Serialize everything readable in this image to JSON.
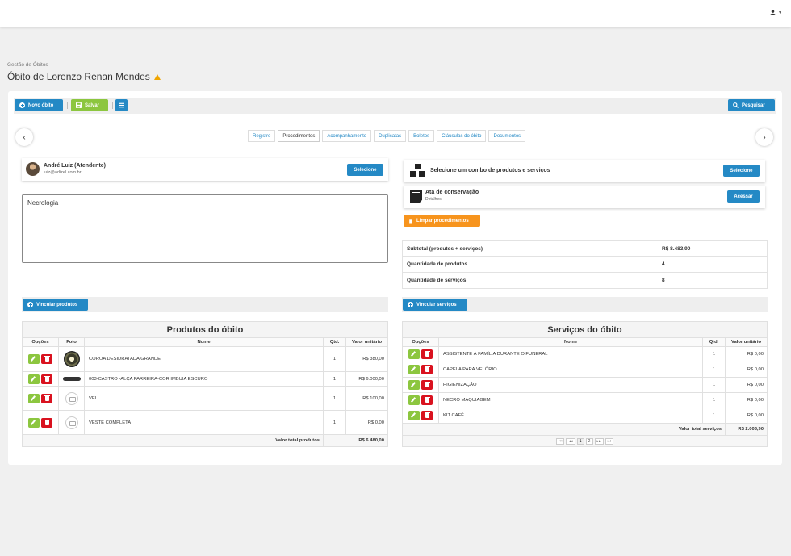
{
  "header": {
    "user_icon": "user-icon",
    "caret": "▾"
  },
  "breadcrumb": "Gestão de Óbitos",
  "page_title": "Óbito de Lorenzo Renan Mendes",
  "toolbar": {
    "new_label": "Novo óbito",
    "save_label": "Salvar",
    "search_label": "Pesquisar"
  },
  "tabs": [
    "Registro",
    "Procedimentos",
    "Acompanhamento",
    "Duplicatas",
    "Boletos",
    "Cláusulas do óbito",
    "Documentos"
  ],
  "active_tab": "Procedimentos",
  "attendant": {
    "name": "André Luiz (Atendente)",
    "email": "luiz@adizel.com.br",
    "select_label": "Selecione"
  },
  "notes": "Necrologia",
  "combo": {
    "title": "Selecione um combo de produtos e serviços",
    "select_label": "Selecione"
  },
  "ata": {
    "title": "Ata de conservação",
    "subtitle": "Detalhes",
    "access_label": "Acessar"
  },
  "clear_label": "Limpar procedimentos",
  "summary": [
    {
      "label": "Subtotal (produtos + serviços)",
      "value": "R$ 8.483,90"
    },
    {
      "label": "Quantidade de produtos",
      "value": "4"
    },
    {
      "label": "Quantidade de serviços",
      "value": "8"
    }
  ],
  "link_products_label": "Vincular produtos",
  "link_services_label": "Vincular serviços",
  "products": {
    "title": "Produtos do óbito",
    "headers": {
      "options": "Opções",
      "photo": "Foto",
      "name": "Nome",
      "qty": "Qtd.",
      "unit": "Valor unitário"
    },
    "rows": [
      {
        "name": "COROA DESIDRATADA GRANDE",
        "qty": "1",
        "unit": "R$ 380,00"
      },
      {
        "name": "003-CASTRO -ALÇA PARREIRA-COR IMBUIA ESCURO",
        "qty": "1",
        "unit": "R$ 6.000,00"
      },
      {
        "name": "VEL",
        "qty": "1",
        "unit": "R$ 100,00"
      },
      {
        "name": "VESTE COMPLETA",
        "qty": "1",
        "unit": "R$ 0,00"
      }
    ],
    "total_label": "Valor total produtos",
    "total_value": "R$ 6.480,00"
  },
  "services": {
    "title": "Serviços do óbito",
    "headers": {
      "options": "Opções",
      "name": "Nome",
      "qty": "Qtd.",
      "unit": "Valor unitário"
    },
    "rows": [
      {
        "name": "ASSISTENTE À FAMÍLIA DURANTE O FUNERAL",
        "qty": "1",
        "unit": "R$ 0,00"
      },
      {
        "name": "CAPELA PARA VELÓRIO",
        "qty": "1",
        "unit": "R$ 0,00"
      },
      {
        "name": "HIGIENIZAÇÃO",
        "qty": "1",
        "unit": "R$ 0,00"
      },
      {
        "name": "NECRO MAQUIAGEM",
        "qty": "1",
        "unit": "R$ 0,00"
      },
      {
        "name": "KIT CAFÉ",
        "qty": "1",
        "unit": "R$ 0,00"
      }
    ],
    "total_label": "Valor total serviços",
    "total_value": "R$ 2.003,90",
    "pager": {
      "first": "⏮",
      "prev": "◂◂",
      "pages": [
        "1",
        "2"
      ],
      "next": "▸▸",
      "last": "⏭"
    }
  }
}
